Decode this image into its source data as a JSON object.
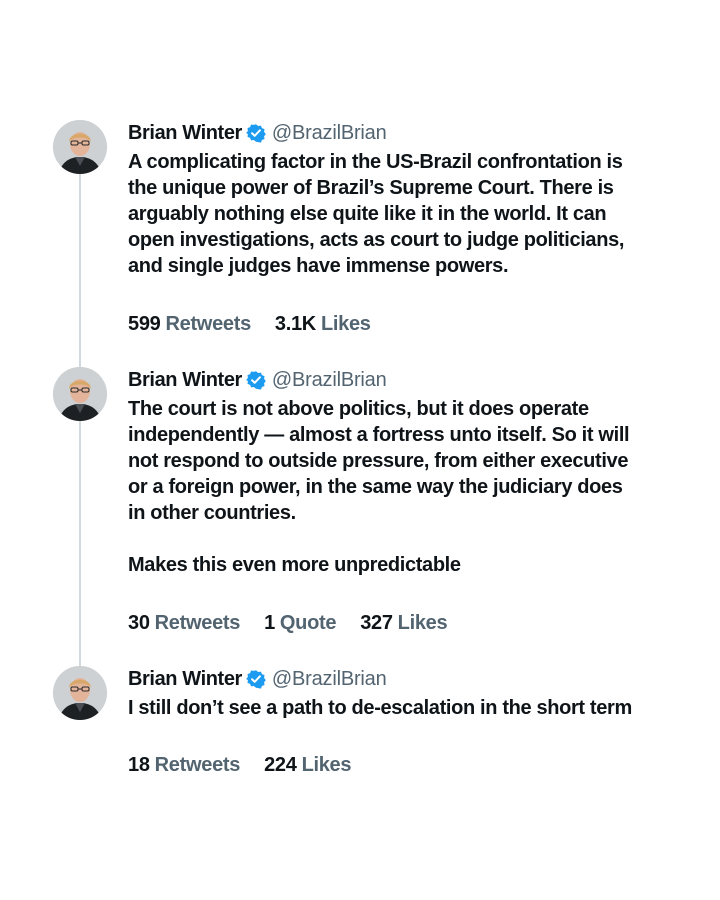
{
  "tweets": [
    {
      "author": "Brian Winter",
      "handle": "@BrazilBrian",
      "text": "A complicating factor in the US-Brazil confrontation is\nthe unique power of Brazil’s Supreme Court. There is\narguably nothing else quite like it in the world. It can\nopen investigations, acts as court to judge politicians,\nand single judges have immense powers.",
      "stats": [
        {
          "value": "599",
          "label": "Retweets"
        },
        {
          "value": "3.1K",
          "label": "Likes"
        }
      ]
    },
    {
      "author": "Brian Winter",
      "handle": "@BrazilBrian",
      "text": "The court is not above politics, but it does operate\nindependently — almost a fortress unto itself. So it will\nnot respond to outside pressure, from either executive\nor a foreign power, in the same way the judiciary does\nin other countries.\n\nMakes this even more unpredictable",
      "stats": [
        {
          "value": "30",
          "label": "Retweets"
        },
        {
          "value": "1",
          "label": "Quote"
        },
        {
          "value": "327",
          "label": "Likes"
        }
      ]
    },
    {
      "author": "Brian Winter",
      "handle": "@BrazilBrian",
      "text": "I still don’t see a path to de-escalation in the short term",
      "stats": [
        {
          "value": "18",
          "label": "Retweets"
        },
        {
          "value": "224",
          "label": "Likes"
        }
      ]
    }
  ],
  "icons": {
    "verified": "verified-badge-icon",
    "avatar": "profile-photo"
  },
  "colors": {
    "verified_blue": "#1d9bf0",
    "secondary_text": "#536471",
    "primary_text": "#0f1419",
    "thread_line": "#cfd9de"
  }
}
